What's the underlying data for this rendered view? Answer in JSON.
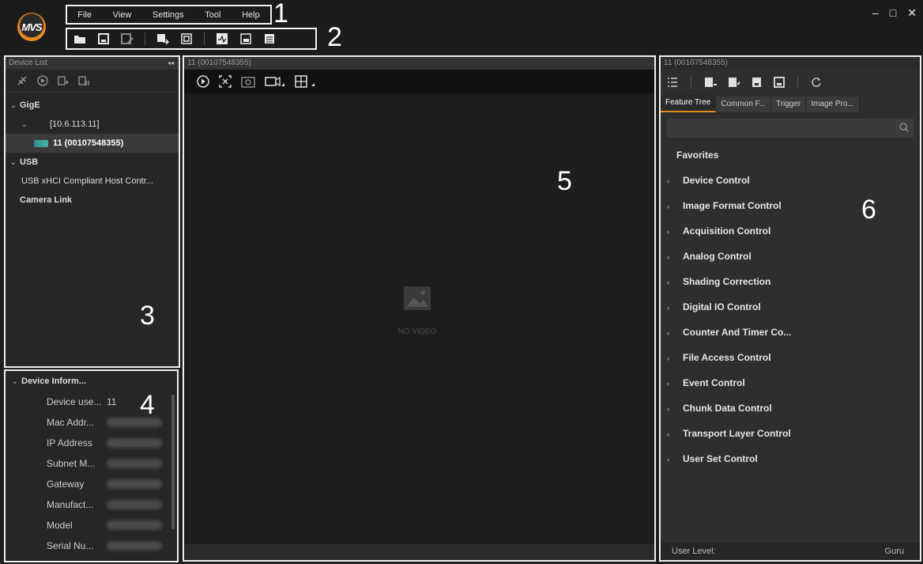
{
  "app": {
    "logo_text": "MVS"
  },
  "menu": [
    "File",
    "View",
    "Settings",
    "Tool",
    "Help"
  ],
  "toolbar_icons": [
    "open-folder-icon",
    "save-icon",
    "save-as-icon",
    "import-icon",
    "export-icon",
    "waveform-icon",
    "display-icon",
    "log-icon"
  ],
  "callouts": {
    "menu": "1",
    "toolbar": "2",
    "device_list": "3",
    "device_info": "4",
    "preview": "5",
    "properties": "6"
  },
  "window_controls": {
    "minimize": "–",
    "maximize": "□",
    "close": "✕"
  },
  "device_list": {
    "title": "Device List",
    "collapse_glyph": "◂◂",
    "tree": [
      {
        "label": "GigE",
        "level": 0,
        "expanded": true,
        "bold": true
      },
      {
        "label": "[10.6.113.11]",
        "level": 1,
        "expanded": true
      },
      {
        "label": "11 (00107548355)",
        "level": 2,
        "selected": true
      },
      {
        "label": "USB",
        "level": 0,
        "expanded": true,
        "bold": true
      },
      {
        "label": "USB xHCI Compliant Host Contr...",
        "level": 1
      },
      {
        "label": "Camera Link",
        "level": 0,
        "bold": true
      }
    ]
  },
  "device_info": {
    "section": "Device Inform...",
    "rows": [
      {
        "label": "Device use...",
        "value": "11"
      },
      {
        "label": "Mac Addr...",
        "value": ""
      },
      {
        "label": "IP Address",
        "value": ""
      },
      {
        "label": "Subnet M...",
        "value": ""
      },
      {
        "label": "Gateway",
        "value": ""
      },
      {
        "label": "Manufact...",
        "value": ""
      },
      {
        "label": "Model",
        "value": ""
      },
      {
        "label": "Serial Nu...",
        "value": ""
      }
    ]
  },
  "preview": {
    "title": "11 (00107548355)",
    "no_video": "NO VIDEO"
  },
  "properties": {
    "title": "11 (00107548355)",
    "tabs": [
      "Feature Tree",
      "Common F...",
      "Trigger",
      "Image Pro..."
    ],
    "active_tab": 0,
    "search_placeholder": "",
    "favorites": "Favorites",
    "features": [
      "Device Control",
      "Image Format Control",
      "Acquisition Control",
      "Analog Control",
      "Shading Correction",
      "Digital IO Control",
      "Counter And Timer Co...",
      "File Access Control",
      "Event Control",
      "Chunk Data Control",
      "Transport Layer Control",
      "User Set Control"
    ],
    "user_level_label": "User Level:",
    "user_level_value": "Guru"
  },
  "colors": {
    "accent": "#e08a1c",
    "border_highlight": "#f0f0f0",
    "background": "#1f1f1f"
  }
}
